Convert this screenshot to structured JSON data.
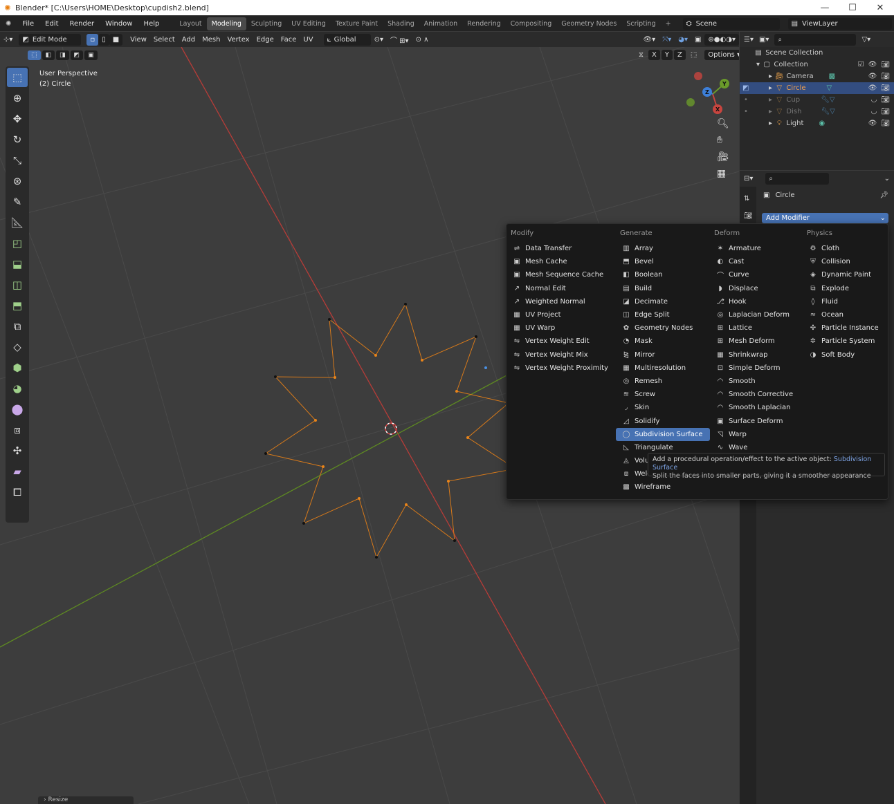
{
  "window": {
    "title": "Blender* [C:\\Users\\HOME\\Desktop\\cupdish2.blend]",
    "logo": "blender-logo",
    "min": "—",
    "max": "☐",
    "close": "✕"
  },
  "topbar": {
    "menus": [
      "File",
      "Edit",
      "Render",
      "Window",
      "Help"
    ],
    "workspaces": [
      "Layout",
      "Modeling",
      "Sculpting",
      "UV Editing",
      "Texture Paint",
      "Shading",
      "Animation",
      "Rendering",
      "Compositing",
      "Geometry Nodes",
      "Scripting"
    ],
    "active_workspace": "Modeling",
    "scene": "Scene",
    "view_layer": "ViewLayer"
  },
  "header": {
    "mode": "Edit Mode",
    "menus": [
      "View",
      "Select",
      "Add",
      "Mesh",
      "Vertex",
      "Edge",
      "Face",
      "UV"
    ],
    "orientation": "Global",
    "options": "Options",
    "axes": [
      "X",
      "Y",
      "Z"
    ]
  },
  "viewport": {
    "view_name": "User Perspective",
    "object_label": "(2) Circle",
    "operator_panel": "Resize"
  },
  "outliner": {
    "root": "Scene Collection",
    "collection": "Collection",
    "items": [
      {
        "name": "Camera",
        "selected": false,
        "hidden": false
      },
      {
        "name": "Circle",
        "selected": true,
        "hidden": false
      },
      {
        "name": "Cup",
        "selected": false,
        "hidden": true
      },
      {
        "name": "Dish",
        "selected": false,
        "hidden": true
      },
      {
        "name": "Light",
        "selected": false,
        "hidden": false
      }
    ]
  },
  "properties": {
    "object_name": "Circle",
    "add_modifier": "Add Modifier"
  },
  "menu": {
    "columns": [
      {
        "title": "Modify",
        "items": [
          "Data Transfer",
          "Mesh Cache",
          "Mesh Sequence Cache",
          "Normal Edit",
          "Weighted Normal",
          "UV Project",
          "UV Warp",
          "Vertex Weight Edit",
          "Vertex Weight Mix",
          "Vertex Weight Proximity"
        ]
      },
      {
        "title": "Generate",
        "items": [
          "Array",
          "Bevel",
          "Boolean",
          "Build",
          "Decimate",
          "Edge Split",
          "Geometry Nodes",
          "Mask",
          "Mirror",
          "Multiresolution",
          "Remesh",
          "Screw",
          "Skin",
          "Solidify",
          "Subdivision Surface",
          "Triangulate",
          "Volume to Mesh",
          "Weld",
          "Wireframe"
        ]
      },
      {
        "title": "Deform",
        "items": [
          "Armature",
          "Cast",
          "Curve",
          "Displace",
          "Hook",
          "Laplacian Deform",
          "Lattice",
          "Mesh Deform",
          "Shrinkwrap",
          "Simple Deform",
          "Smooth",
          "Smooth Corrective",
          "Smooth Laplacian",
          "Surface Deform",
          "Warp",
          "Wave"
        ]
      },
      {
        "title": "Physics",
        "items": [
          "Cloth",
          "Collision",
          "Dynamic Paint",
          "Explode",
          "Fluid",
          "Ocean",
          "Particle Instance",
          "Particle System",
          "Soft Body"
        ]
      }
    ],
    "highlighted": "Subdivision Surface"
  },
  "tooltip": {
    "line1_prefix": "Add a procedural operation/effect to the active object:",
    "line1_value": "Subdivision Surface",
    "line2": "Split the faces into smaller parts, giving it a smoother appearance"
  },
  "colors": {
    "accent": "#4772b3",
    "x_axis": "#c8453f",
    "y_axis": "#6a9a2a",
    "selected_edge": "#e8841a"
  }
}
